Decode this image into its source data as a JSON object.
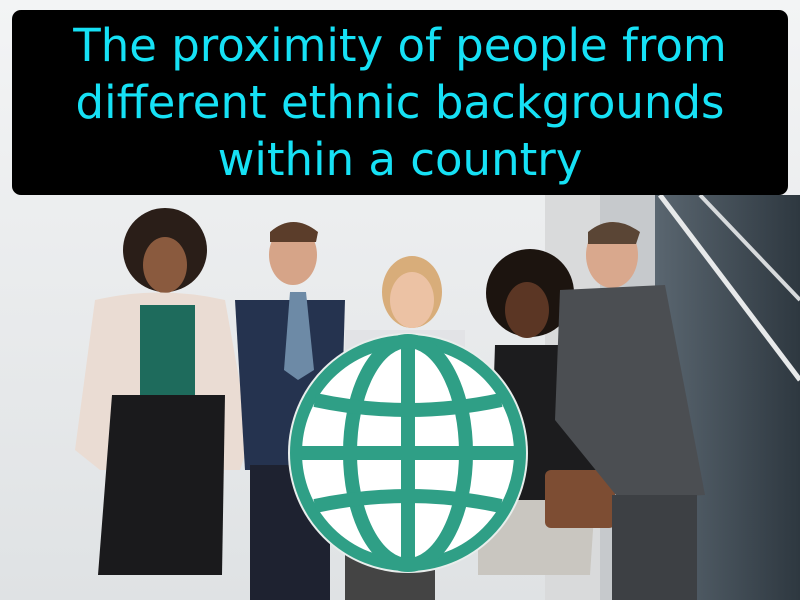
{
  "caption": {
    "line1": "The proximity of people from",
    "line2": "different ethnic backgrounds",
    "line3": "within a country"
  },
  "colors": {
    "caption_bg": "#000000",
    "caption_text": "#16e1f5",
    "globe_teal": "#2f9f86",
    "globe_fill": "#ffffff"
  },
  "icons": [
    "globe-icon"
  ]
}
